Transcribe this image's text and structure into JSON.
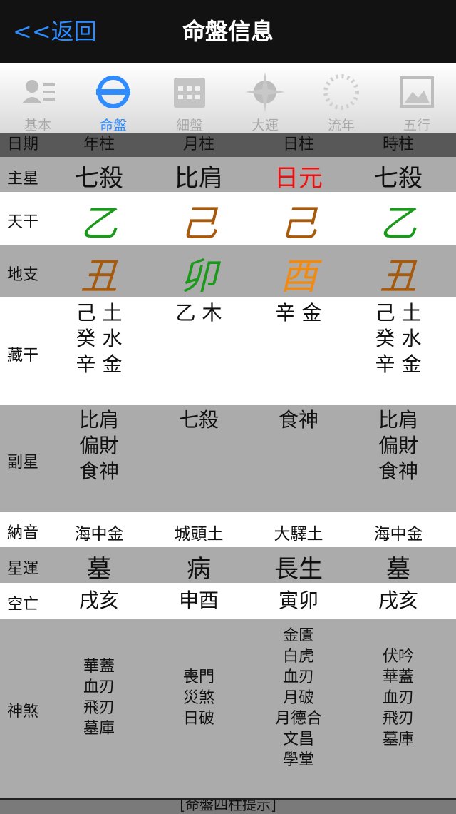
{
  "nav": {
    "back": "<<返回",
    "title": "命盤信息"
  },
  "tabs": [
    {
      "label": "基本",
      "icon": "profile-card-icon"
    },
    {
      "label": "命盤",
      "icon": "ring-bar-icon"
    },
    {
      "label": "細盤",
      "icon": "calendar-icon"
    },
    {
      "label": "大運",
      "icon": "compass-icon"
    },
    {
      "label": "流年",
      "icon": "dotted-circle-icon"
    },
    {
      "label": "五行",
      "icon": "picture-frame-icon"
    }
  ],
  "active_tab": "命盤",
  "colors": {
    "fire_red": "#ee1111",
    "wood_green": "#1a9a1a",
    "earth_brown": "#a65a0e",
    "metal_orange": "#f08a10",
    "link_blue": "#2f8cff"
  },
  "header": {
    "label": "日期",
    "cols": [
      "年柱",
      "月柱",
      "日柱",
      "時柱"
    ]
  },
  "rows": {
    "main_star": {
      "label": "主星",
      "values": [
        "七殺",
        "比肩",
        "日元",
        "七殺"
      ]
    },
    "heavenly_stem": {
      "label": "天干",
      "values": [
        "乙",
        "己",
        "己",
        "乙"
      ]
    },
    "earthly_branch": {
      "label": "地支",
      "values": [
        "丑",
        "卯",
        "酉",
        "丑"
      ]
    },
    "hidden_stems": {
      "label": "藏干",
      "values": [
        "己 土\n癸 水\n辛 金",
        "乙 木",
        "辛 金",
        "己 土\n癸 水\n辛 金"
      ]
    },
    "sub_star": {
      "label": "副星",
      "values": [
        "比肩\n偏財\n食神",
        "七殺",
        "食神",
        "比肩\n偏財\n食神"
      ]
    },
    "nayin": {
      "label": "納音",
      "values": [
        "海中金",
        "城頭土",
        "大驛土",
        "海中金"
      ]
    },
    "star_cycle": {
      "label": "星運",
      "values": [
        "墓",
        "病",
        "長生",
        "墓"
      ]
    },
    "void": {
      "label": "空亡",
      "values": [
        "戌亥",
        "申酉",
        "寅卯",
        "戌亥"
      ]
    },
    "shensha": {
      "label": "神煞",
      "values": [
        [
          "華蓋",
          "血刃",
          "飛刃",
          "墓庫"
        ],
        [
          "喪門",
          "災煞",
          "日破"
        ],
        [
          "金匱",
          "白虎",
          "血刃",
          "月破",
          "月德合",
          "文昌",
          "學堂"
        ],
        [
          "伏吟",
          "華蓋",
          "血刃",
          "飛刃",
          "墓庫"
        ]
      ]
    }
  },
  "footer": "[命盤四柱提示]"
}
